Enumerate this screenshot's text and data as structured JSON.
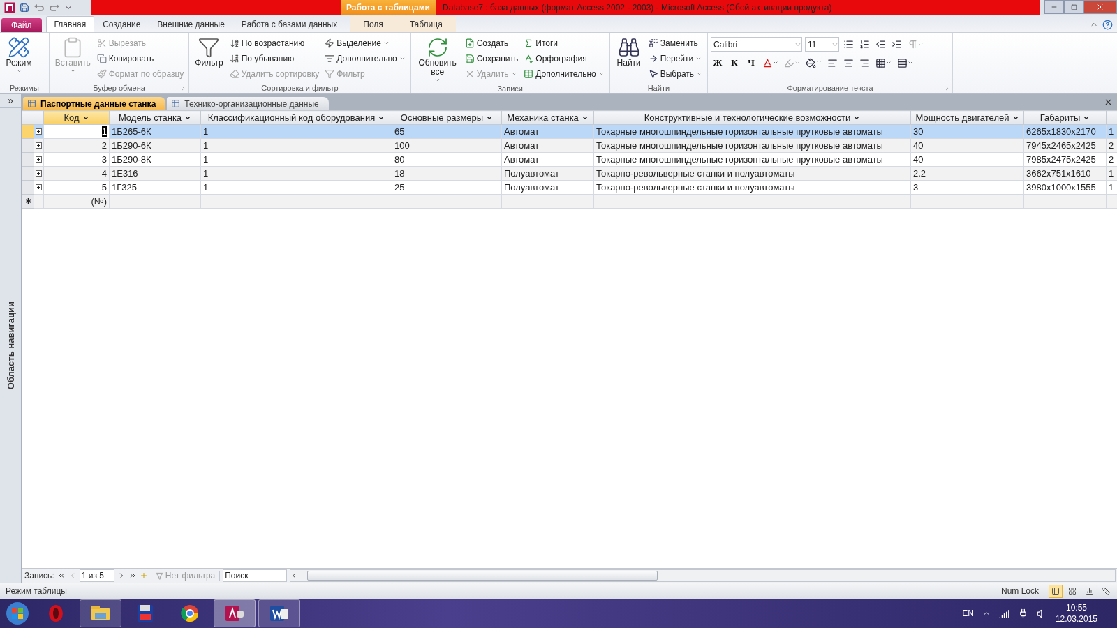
{
  "title_bar": {
    "context_tab": "Работа с таблицами",
    "title": "Database7 : база данных (формат Access 2002 - 2003)  -  Microsoft Access (Сбой активации продукта)"
  },
  "ribbon_tabs": [
    {
      "label": "Файл",
      "kind": "file",
      "selected": false
    },
    {
      "label": "Главная",
      "kind": "tab",
      "selected": true
    },
    {
      "label": "Создание",
      "kind": "tab",
      "selected": false
    },
    {
      "label": "Внешние данные",
      "kind": "tab",
      "selected": false
    },
    {
      "label": "Работа с базами данных",
      "kind": "tab",
      "selected": false
    },
    {
      "label": "Поля",
      "kind": "context",
      "selected": false
    },
    {
      "label": "Таблица",
      "kind": "context",
      "selected": false
    }
  ],
  "ribbon_groups": [
    {
      "label": "Режимы",
      "launcher": false,
      "items": [
        {
          "label": "Режим",
          "kind": "large",
          "disabled": false,
          "dropdown": true
        }
      ]
    },
    {
      "label": "Буфер обмена",
      "launcher": true,
      "items": [
        {
          "label": "Вставить",
          "kind": "large",
          "disabled": true,
          "dropdown": true
        },
        {
          "label": "Вырезать",
          "kind": "small",
          "disabled": true,
          "dropdown": false
        },
        {
          "label": "Копировать",
          "kind": "small",
          "disabled": false,
          "dropdown": false
        },
        {
          "label": "Формат по образцу",
          "kind": "small",
          "disabled": true,
          "dropdown": false
        }
      ]
    },
    {
      "label": "Сортировка и фильтр",
      "launcher": false,
      "items": [
        {
          "label": "Фильтр",
          "kind": "large",
          "disabled": false,
          "dropdown": false
        },
        {
          "label": "По возрастанию",
          "kind": "small",
          "disabled": false,
          "dropdown": false
        },
        {
          "label": "По убыванию",
          "kind": "small",
          "disabled": false,
          "dropdown": false
        },
        {
          "label": "Удалить сортировку",
          "kind": "small",
          "disabled": true,
          "dropdown": false
        },
        {
          "label": "Выделение",
          "kind": "small",
          "disabled": false,
          "dropdown": true
        },
        {
          "label": "Дополнительно",
          "kind": "small",
          "disabled": false,
          "dropdown": true
        },
        {
          "label": "Фильтр",
          "kind": "small",
          "disabled": true,
          "dropdown": false
        }
      ]
    },
    {
      "label": "Записи",
      "launcher": false,
      "items": [
        {
          "label": "Обновить все",
          "kind": "large",
          "disabled": false,
          "dropdown": true
        },
        {
          "label": "Создать",
          "kind": "small",
          "disabled": false,
          "dropdown": false
        },
        {
          "label": "Сохранить",
          "kind": "small",
          "disabled": false,
          "dropdown": false
        },
        {
          "label": "Удалить",
          "kind": "small",
          "disabled": true,
          "dropdown": true
        },
        {
          "label": "Итоги",
          "kind": "small",
          "disabled": false,
          "dropdown": false
        },
        {
          "label": "Орфография",
          "kind": "small",
          "disabled": false,
          "dropdown": false
        },
        {
          "label": "Дополнительно",
          "kind": "small",
          "disabled": false,
          "dropdown": true
        }
      ]
    },
    {
      "label": "Найти",
      "launcher": false,
      "items": [
        {
          "label": "Найти",
          "kind": "large",
          "disabled": false,
          "dropdown": false
        },
        {
          "label": "Заменить",
          "kind": "small",
          "disabled": false,
          "dropdown": false
        },
        {
          "label": "Перейти",
          "kind": "small",
          "disabled": false,
          "dropdown": true
        },
        {
          "label": "Выбрать",
          "kind": "small",
          "disabled": false,
          "dropdown": true
        }
      ]
    }
  ],
  "font_group": {
    "label": "Форматирование текста",
    "launcher": true,
    "top_controls": [
      {
        "kind": "combo",
        "value": "Calibri",
        "wide": true
      },
      {
        "kind": "combo",
        "value": "11",
        "wide": false
      },
      {
        "kind": "tool",
        "disabled": false,
        "dropdown": false
      },
      {
        "kind": "tool",
        "disabled": false,
        "dropdown": false
      },
      {
        "kind": "tool",
        "disabled": false,
        "dropdown": false
      },
      {
        "kind": "tool",
        "disabled": false,
        "dropdown": false
      },
      {
        "kind": "tool",
        "disabled": true,
        "dropdown": true
      }
    ],
    "bottom_controls": [
      {
        "kind": "letter",
        "text": "Ж",
        "disabled": false
      },
      {
        "kind": "letter",
        "text": "К",
        "disabled": false
      },
      {
        "kind": "letter",
        "text": "Ч",
        "disabled": false
      },
      {
        "kind": "tool",
        "disabled": false,
        "dropdown": true
      },
      {
        "kind": "tool",
        "disabled": true,
        "dropdown": true
      },
      {
        "kind": "tool",
        "disabled": false,
        "dropdown": true
      },
      {
        "kind": "tool",
        "disabled": false,
        "dropdown": false
      },
      {
        "kind": "tool",
        "disabled": false,
        "dropdown": false
      },
      {
        "kind": "tool",
        "disabled": false,
        "dropdown": false
      },
      {
        "kind": "tool",
        "disabled": false,
        "dropdown": true
      },
      {
        "kind": "tool",
        "disabled": false,
        "dropdown": true
      }
    ]
  },
  "nav_pane": {
    "toggle": "»",
    "label": "Область навигации"
  },
  "doc_tabs": [
    {
      "label": "Паспортные данные станка",
      "selected": true
    },
    {
      "label": "Технико-организационные данные",
      "selected": false
    }
  ],
  "table": {
    "columns": [
      "Код",
      "Модель станка",
      "Классификационный код оборудования",
      "Основные размеры",
      "Механика станка",
      "Конструктивные и технологические возможности",
      "Мощность двигателей",
      "Габариты"
    ],
    "rows": [
      {
        "selected": true,
        "cells": [
          "1",
          "1Б265-6К",
          "1",
          "65",
          "Автомат",
          "Токарные многошпиндельные горизонтальные прутковые автоматы",
          "30",
          "6265х1830х2170",
          "1"
        ]
      },
      {
        "selected": false,
        "cells": [
          "2",
          "1Б290-6К",
          "1",
          "100",
          "Автомат",
          "Токарные многошпиндельные горизонтальные прутковые автоматы",
          "40",
          "7945х2465х2425",
          "2"
        ]
      },
      {
        "selected": false,
        "cells": [
          "3",
          "1Б290-8К",
          "1",
          "80",
          "Автомат",
          "Токарные многошпиндельные горизонтальные прутковые автоматы",
          "40",
          "7985х2475х2425",
          "2"
        ]
      },
      {
        "selected": false,
        "cells": [
          "4",
          "1Е316",
          "1",
          "18",
          "Полуавтомат",
          "Токарно-револьверные станки и полуавтоматы",
          "2.2",
          "3662х751х1610",
          "1"
        ]
      },
      {
        "selected": false,
        "cells": [
          "5",
          "1Г325",
          "1",
          "25",
          "Полуавтомат",
          "Токарно-револьверные станки и полуавтоматы",
          "3",
          "3980х1000х1555",
          "1"
        ]
      }
    ],
    "new_row": {
      "marker": "✱",
      "code": "(№)"
    }
  },
  "record_nav": {
    "label": "Запись:",
    "position": "1 из 5",
    "filter": "Нет фильтра",
    "search_placeholder": "Поиск"
  },
  "status_bar": {
    "mode": "Режим таблицы",
    "num_lock": "Num Lock",
    "views": [
      {
        "selected": true
      },
      {
        "selected": false
      },
      {
        "selected": false
      },
      {
        "selected": false
      }
    ]
  },
  "taskbar": {
    "apps": [
      {
        "running": false,
        "selected": false
      },
      {
        "running": true,
        "selected": false
      },
      {
        "running": false,
        "selected": false
      },
      {
        "running": false,
        "selected": false
      },
      {
        "running": true,
        "selected": true
      },
      {
        "running": true,
        "selected": false
      }
    ],
    "language": "EN",
    "time": "10:55",
    "date": "12.03.2015"
  }
}
